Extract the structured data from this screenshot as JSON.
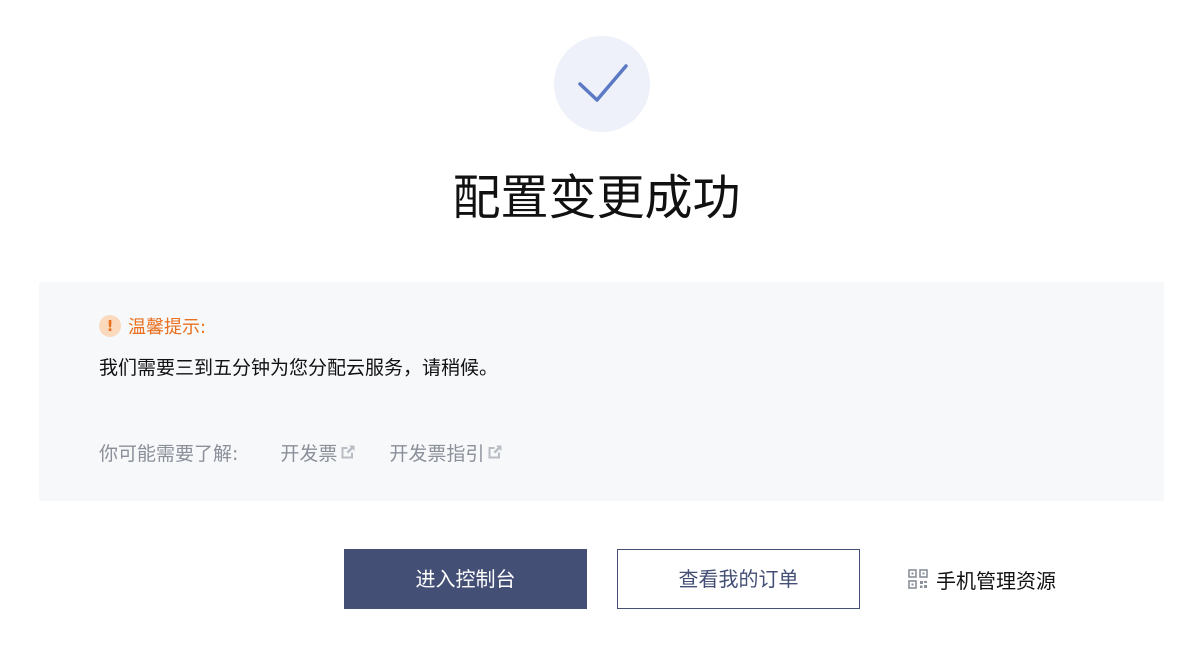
{
  "status": {
    "title": "配置变更成功",
    "icon": "check-icon",
    "icon_color": "#5b79c4",
    "icon_bg": "#eef1f9"
  },
  "tip": {
    "icon": "warning-icon",
    "icon_glyph": "!",
    "label": "温馨提示:",
    "message": "我们需要三到五分钟为您分配云服务，请稍候。",
    "accent_color": "#e8701f"
  },
  "related": {
    "label": "你可能需要了解:",
    "links": [
      {
        "label": "开发票",
        "icon": "external-link-icon"
      },
      {
        "label": "开发票指引",
        "icon": "external-link-icon"
      }
    ]
  },
  "actions": {
    "console_label": "进入控制台",
    "orders_label": "查看我的订单",
    "mobile_label": "手机管理资源",
    "mobile_icon": "qr-code-icon",
    "primary_color": "#444f75"
  }
}
